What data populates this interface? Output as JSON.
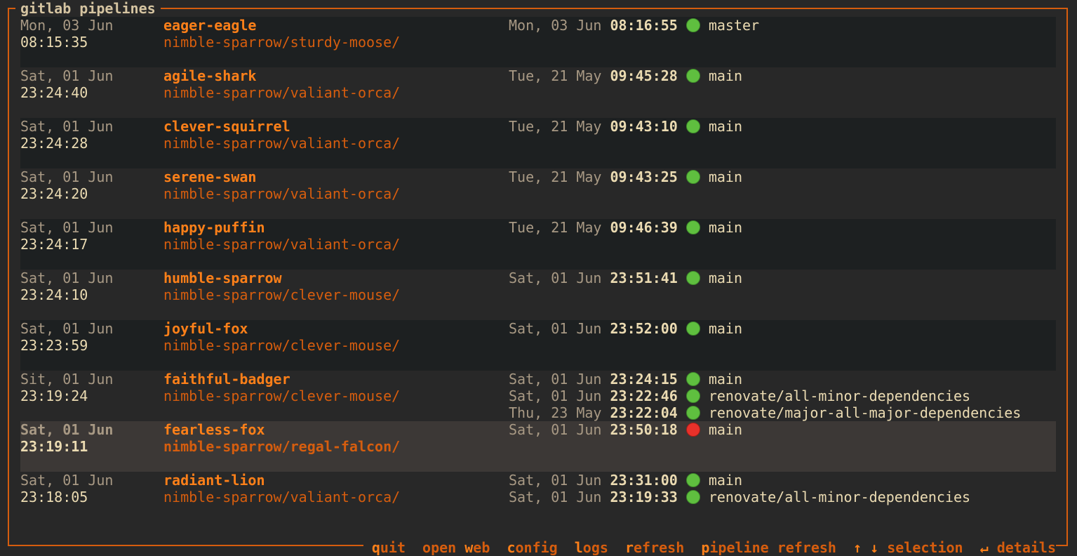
{
  "app": {
    "title": "gitlab pipelines"
  },
  "rows": [
    {
      "date": "Mon, 03 Jun",
      "time": "08:15:35",
      "name": "eager-eagle",
      "path": "nimble-sparrow/sturdy-moose/",
      "refs": [
        {
          "date": "Mon, 03 Jun",
          "time": "08:16:55",
          "status": "success",
          "branch": "master"
        }
      ]
    },
    {
      "date": "Sat, 01 Jun",
      "time": "23:24:40",
      "name": "agile-shark",
      "path": "nimble-sparrow/valiant-orca/",
      "refs": [
        {
          "date": "Tue, 21 May",
          "time": "09:45:28",
          "status": "success",
          "branch": "main"
        }
      ]
    },
    {
      "date": "Sat, 01 Jun",
      "time": "23:24:28",
      "name": "clever-squirrel",
      "path": "nimble-sparrow/valiant-orca/",
      "refs": [
        {
          "date": "Tue, 21 May",
          "time": "09:43:10",
          "status": "success",
          "branch": "main"
        }
      ]
    },
    {
      "date": "Sat, 01 Jun",
      "time": "23:24:20",
      "name": "serene-swan",
      "path": "nimble-sparrow/valiant-orca/",
      "refs": [
        {
          "date": "Tue, 21 May",
          "time": "09:43:25",
          "status": "success",
          "branch": "main"
        }
      ]
    },
    {
      "date": "Sat, 01 Jun",
      "time": "23:24:17",
      "name": "happy-puffin",
      "path": "nimble-sparrow/valiant-orca/",
      "refs": [
        {
          "date": "Tue, 21 May",
          "time": "09:46:39",
          "status": "success",
          "branch": "main"
        }
      ]
    },
    {
      "date": "Sat, 01 Jun",
      "time": "23:24:10",
      "name": "humble-sparrow",
      "path": "nimble-sparrow/clever-mouse/",
      "refs": [
        {
          "date": "Sat, 01 Jun",
          "time": "23:51:41",
          "status": "success",
          "branch": "main"
        }
      ]
    },
    {
      "date": "Sat, 01 Jun",
      "time": "23:23:59",
      "name": "joyful-fox",
      "path": "nimble-sparrow/clever-mouse/",
      "refs": [
        {
          "date": "Sat, 01 Jun",
          "time": "23:52:00",
          "status": "success",
          "branch": "main"
        }
      ]
    },
    {
      "date": "Sit, 01 Jun",
      "time": "23:19:24",
      "name": "faithful-badger",
      "path": "nimble-sparrow/clever-mouse/",
      "refs": [
        {
          "date": "Sat, 01 Jun",
          "time": "23:24:15",
          "status": "success",
          "branch": "main"
        },
        {
          "date": "Sat, 01 Jun",
          "time": "23:22:46",
          "status": "success",
          "branch": "renovate/all-minor-dependencies"
        },
        {
          "date": "Thu, 23 May",
          "time": "23:22:04",
          "status": "success",
          "branch": "renovate/major-all-major-dependencies"
        }
      ]
    },
    {
      "date": "Sat, 01 Jun",
      "time": "23:19:11",
      "name": "fearless-fox",
      "path": "nimble-sparrow/regal-falcon/",
      "selected": true,
      "refs": [
        {
          "date": "Sat, 01 Jun",
          "time": "23:50:18",
          "status": "failed",
          "branch": "main"
        }
      ]
    },
    {
      "date": "Sat, 01 Jun",
      "time": "23:18:05",
      "name": "radiant-lion",
      "path": "nimble-sparrow/valiant-orca/",
      "refs": [
        {
          "date": "Sat, 01 Jun",
          "time": "23:31:00",
          "status": "success",
          "branch": "main"
        },
        {
          "date": "Sat, 01 Jun",
          "time": "23:19:33",
          "status": "success",
          "branch": "renovate/all-minor-dependencies"
        }
      ]
    }
  ],
  "footer": {
    "keys": [
      {
        "key": "q",
        "rest": "uit"
      },
      {
        "pre": "open ",
        "key": "w",
        "rest": "eb"
      },
      {
        "key": "c",
        "rest": "onfig"
      },
      {
        "key": "l",
        "rest": "ogs"
      },
      {
        "key": "r",
        "rest": "efresh"
      },
      {
        "key": "p",
        "rest": "ipeline refresh"
      },
      {
        "key": "↑ ↓",
        "rest": " selection"
      },
      {
        "key": "↵",
        "rest": " details"
      }
    ]
  },
  "colors": {
    "accent": "#d65d0e",
    "name": "#fe8019",
    "success": "#5fbf3f",
    "failed": "#e8312a",
    "selected_bg": "#3c3836"
  }
}
